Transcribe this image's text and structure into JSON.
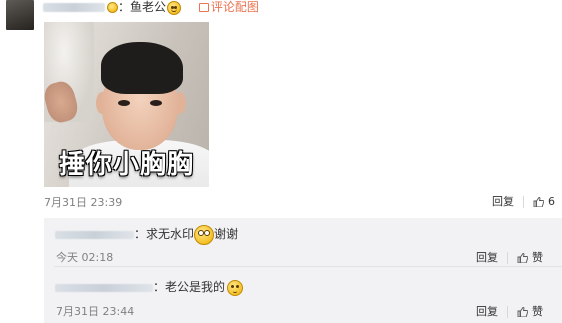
{
  "post": {
    "colon_text": "：鱼老公",
    "comment_image_link": "评论配图",
    "image_caption": "捶你小胸胸",
    "time": "7月31日 23:39",
    "reply_label": "回复",
    "like_count": "6"
  },
  "replies": [
    {
      "text_before": "：求无水印",
      "text_after": "谢谢",
      "time": "今天 02:18",
      "reply_label": "回复",
      "like_label": "赞"
    },
    {
      "text_before": "：老公是我的",
      "text_after": "",
      "time": "7月31日 23:44",
      "reply_label": "回复",
      "like_label": "赞"
    }
  ],
  "icons": [
    "avatar",
    "laugh-emoji-icon",
    "image-icon",
    "thumb-up-icon",
    "big-eyes-emoji-icon",
    "kiss-emoji-icon"
  ],
  "colors": {
    "link": "#eb7350",
    "reply_bg": "#f2f2f5",
    "time": "#808080"
  }
}
